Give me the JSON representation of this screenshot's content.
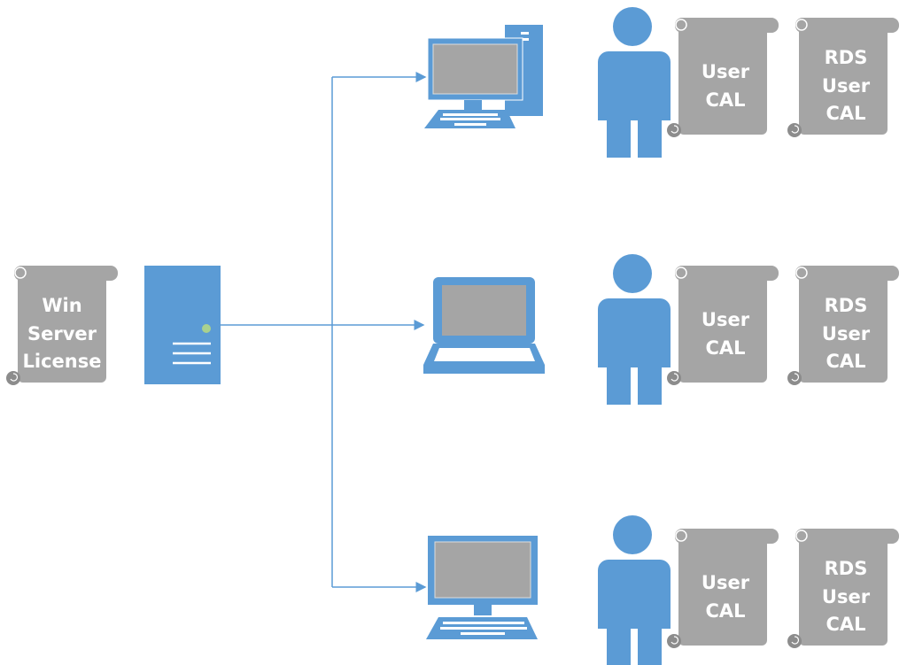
{
  "colors": {
    "device_blue": "#5b9bd5",
    "license_gray": "#a5a5a5",
    "status_green": "#a9d18e",
    "connector": "#5b9bd5"
  },
  "server_license": {
    "lines": [
      "Win",
      "Server",
      "License"
    ]
  },
  "rows": [
    {
      "device": "desktop-computer",
      "user_cal": {
        "lines": [
          "User",
          "CAL"
        ]
      },
      "rds_cal": {
        "lines": [
          "RDS",
          "User",
          "CAL"
        ]
      }
    },
    {
      "device": "laptop",
      "user_cal": {
        "lines": [
          "User",
          "CAL"
        ]
      },
      "rds_cal": {
        "lines": [
          "RDS",
          "User",
          "CAL"
        ]
      }
    },
    {
      "device": "monitor-keyboard",
      "user_cal": {
        "lines": [
          "User",
          "CAL"
        ]
      },
      "rds_cal": {
        "lines": [
          "RDS",
          "User",
          "CAL"
        ]
      }
    }
  ]
}
